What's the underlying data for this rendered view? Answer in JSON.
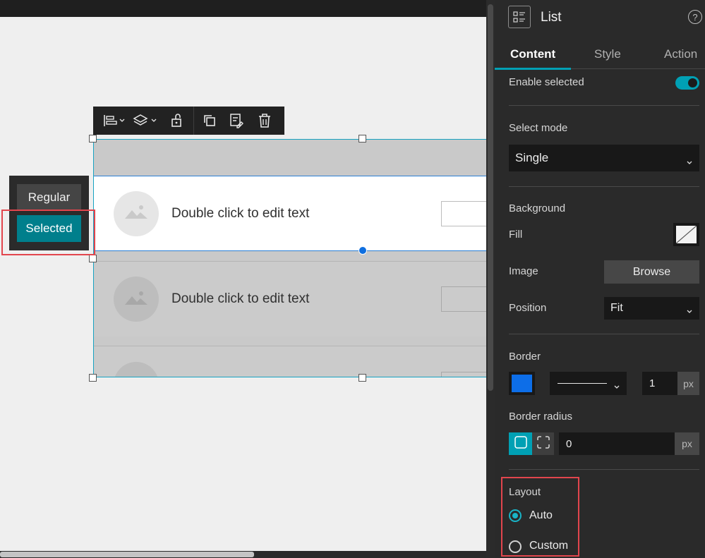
{
  "canvas": {
    "state_switcher": {
      "regular_label": "Regular",
      "selected_label": "Selected"
    },
    "list": {
      "items": [
        {
          "text": "Double click to edit text",
          "state": "selected"
        },
        {
          "text": "Double click to edit text",
          "state": "regular"
        }
      ]
    }
  },
  "toolbar": {
    "icons": [
      "align-icon",
      "layers-icon",
      "unlock-icon",
      "duplicate-icon",
      "edit-content-icon",
      "delete-icon"
    ]
  },
  "panel": {
    "title": "List",
    "help": "?",
    "tabs": [
      {
        "label": "Content",
        "active": true
      },
      {
        "label": "Style",
        "active": false
      },
      {
        "label": "Action",
        "active": false
      }
    ],
    "enable_selected": {
      "label": "Enable selected",
      "on": true
    },
    "select_mode": {
      "label": "Select mode",
      "value": "Single"
    },
    "background": {
      "section_label": "Background",
      "fill_label": "Fill",
      "image_label": "Image",
      "browse_label": "Browse",
      "position_label": "Position",
      "position_value": "Fit"
    },
    "border": {
      "section_label": "Border",
      "color": "#0d6ee8",
      "width": "1",
      "unit": "px"
    },
    "border_radius": {
      "section_label": "Border radius",
      "value": "0",
      "unit": "px"
    },
    "layout": {
      "section_label": "Layout",
      "options": [
        {
          "label": "Auto",
          "checked": true
        },
        {
          "label": "Custom",
          "checked": false
        }
      ]
    }
  },
  "colors": {
    "accent": "#00a0b4",
    "highlight": "#e2454d",
    "selection_border": "#17a3c2"
  }
}
